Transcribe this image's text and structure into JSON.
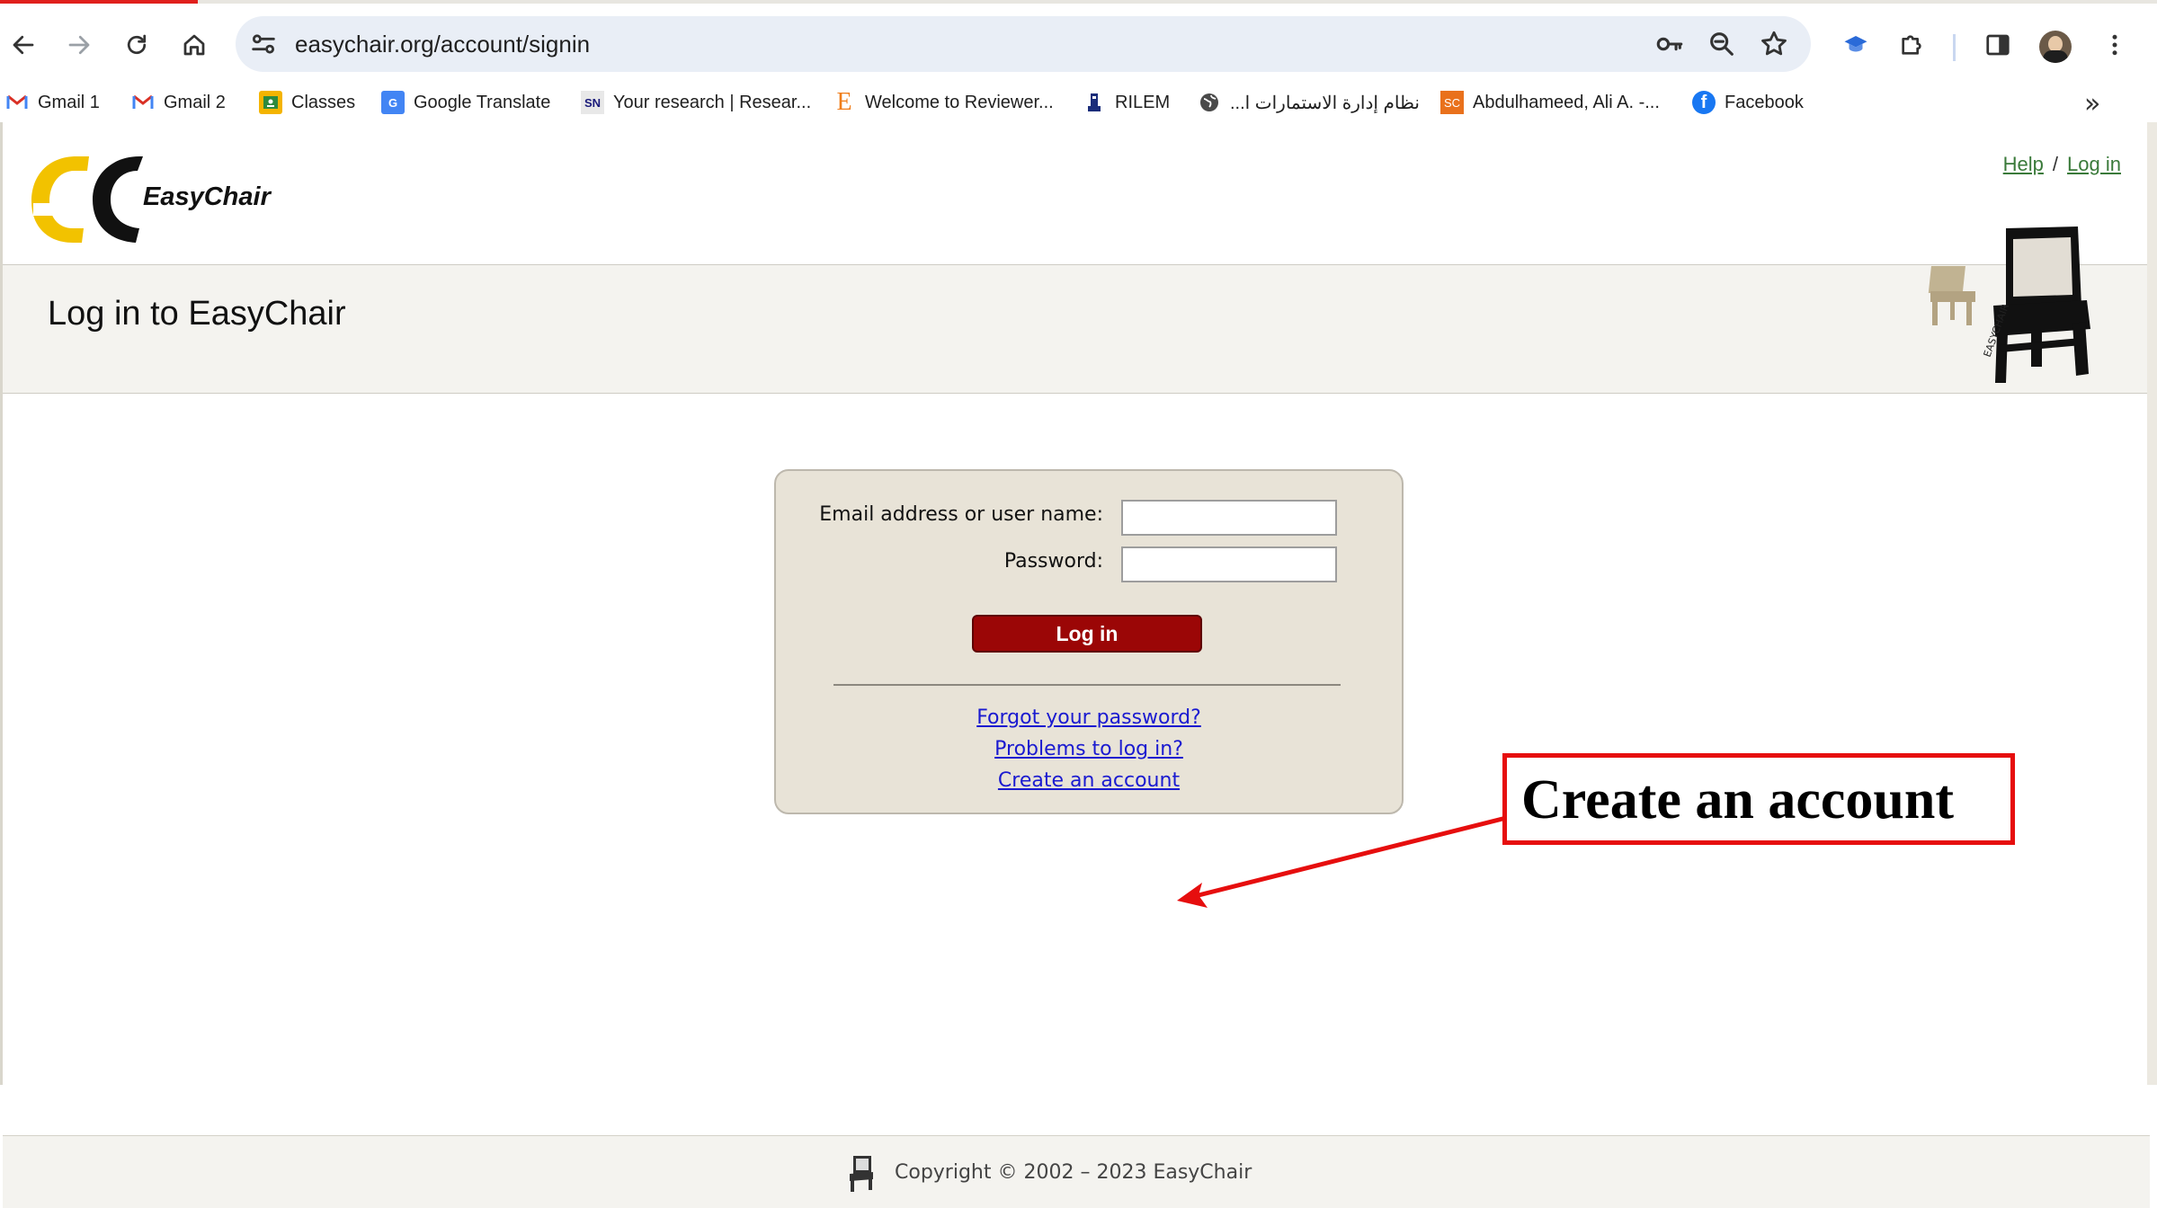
{
  "browser": {
    "url": "easychair.org/account/signin",
    "bookmarks": [
      {
        "label": "Gmail 1",
        "icon": "gmail-icon"
      },
      {
        "label": "Gmail 2",
        "icon": "gmail-icon"
      },
      {
        "label": "Classes",
        "icon": "classroom-icon"
      },
      {
        "label": "Google Translate",
        "icon": "translate-icon"
      },
      {
        "label": "Your research | Resear...",
        "icon": "sn-icon",
        "icon_text": "SN"
      },
      {
        "label": "Welcome to Reviewer...",
        "icon": "elsevier-icon",
        "icon_text": "E"
      },
      {
        "label": "RILEM",
        "icon": "rilem-icon"
      },
      {
        "label": "نظام إدارة الاستمارات ا...",
        "icon": "globe-icon"
      },
      {
        "label": "Abdulhameed, Ali A. -...",
        "icon": "sc-icon",
        "icon_text": "SC"
      },
      {
        "label": "Facebook",
        "icon": "facebook-icon"
      }
    ],
    "more_glyph": "»"
  },
  "site": {
    "brand": "EasyChair",
    "help_link": "Help",
    "separator": "/",
    "login_link": "Log in",
    "chair_caption": "EASYCHAIR"
  },
  "page": {
    "title": "Log in to EasyChair"
  },
  "login_form": {
    "email_label": "Email address or user name:",
    "email_value": "",
    "password_label": "Password:",
    "password_value": "",
    "submit_label": "Log in",
    "links": {
      "forgot": "Forgot your password?",
      "problems": "Problems to log in?",
      "create": "Create an account"
    }
  },
  "annotation": {
    "text": "Create an account",
    "color": "#e60e0e"
  },
  "footer": {
    "copyright": "Copyright © 2002 – 2023 EasyChair"
  },
  "colors": {
    "login_button": "#9b0606",
    "form_background": "#e8e3d7",
    "link": "#1a1ad0",
    "header_link": "#3a7a3a",
    "logo_yellow": "#f2c200"
  }
}
